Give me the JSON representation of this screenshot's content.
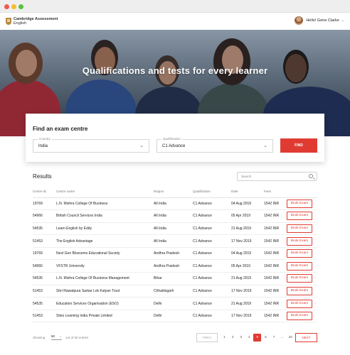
{
  "header": {
    "logo_line1": "Cambridge Assessment",
    "logo_line2": "English",
    "user_greeting": "Hello! Gene Clarke"
  },
  "hero": {
    "title": "Qualifications and tests for every learner"
  },
  "find": {
    "title": "Find an exam centre",
    "country_label": "Country",
    "country_value": "India",
    "qualification_label": "Qualification",
    "qualification_value": "C1 Advance",
    "button_label": "FIND"
  },
  "results": {
    "title": "Results",
    "search_placeholder": "Search",
    "columns": [
      "Centre ID",
      "Centre name",
      "Region",
      "Qualification",
      "Date",
      "Fees",
      ""
    ],
    "rows": [
      [
        "19769",
        "L.N. Mishra College Of Business",
        "All India",
        "C1 Advance",
        "04 Aug 2019",
        "1542 INR"
      ],
      [
        "54966",
        "British Council Services India",
        "All India",
        "C1 Advance",
        "05 Apr 2019",
        "1542 INR"
      ],
      [
        "54535",
        "Learn English by Eddy",
        "All India",
        "C1 Advance",
        "21 Aug 2019",
        "1542 INR"
      ],
      [
        "51453",
        "The English Advantage",
        "All India",
        "C1 Advance",
        "17 Nov 2019",
        "1542 INR"
      ],
      [
        "19769",
        "Next Gen Blossoms Educational Society",
        "Andhra Pradesh",
        "C1 Advance",
        "04 Aug 2019",
        "1542 INR"
      ],
      [
        "54966",
        "VFSTR University",
        "Andhra Pradesh",
        "C1 Advance",
        "05 Apr 2019",
        "1542 INR"
      ],
      [
        "54535",
        "L.N. Mishra College Of Business Management",
        "Bihar",
        "C1 Advance",
        "21 Aug 2019",
        "1542 INR"
      ],
      [
        "51453",
        "Shri Rawatpura Sarkar Lok Kalyan Trust",
        "Chhattisgarh",
        "C1 Advance",
        "17 Nov 2019",
        "1542 INR"
      ],
      [
        "54535",
        "Education Services Organisation (ESO)",
        "Delhi",
        "C1 Advance",
        "21 Aug 2019",
        "1542 INR"
      ],
      [
        "51453",
        "Sites Learning India Private Limited",
        "Delhi",
        "C1 Advance",
        "17 Nov 2019",
        "1542 INR"
      ]
    ],
    "book_label": "Book Exam"
  },
  "pagination": {
    "showing_label": "Showing",
    "per_page": "50",
    "total_label": "out of 60 entries",
    "prev_label": "PREV",
    "pages": [
      "1",
      "2",
      "3",
      "4",
      "5",
      "6",
      "7",
      "...",
      "20"
    ],
    "active_page": "5",
    "next_label": "NEXT"
  },
  "colors": {
    "accent": "#e03b32",
    "brand_gold": "#b78a3b"
  }
}
